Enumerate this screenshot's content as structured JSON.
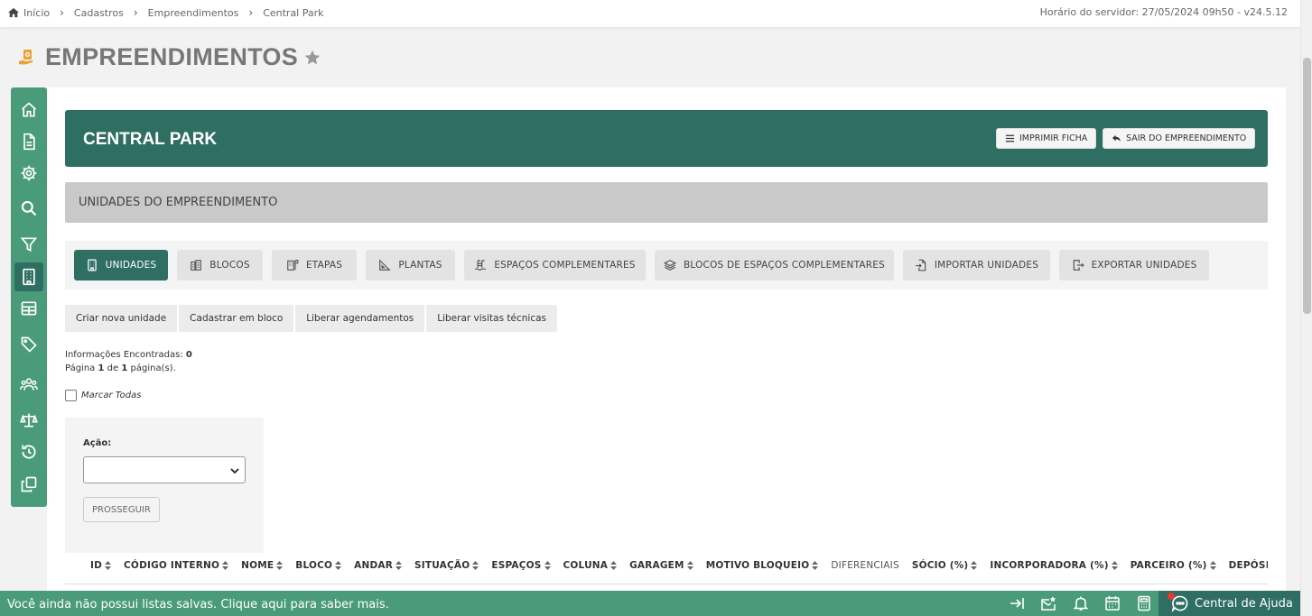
{
  "breadcrumb": [
    "Início",
    "Cadastros",
    "Empreendimentos",
    "Central Park"
  ],
  "server_info": "Horário do servidor: 27/05/2024 09h50 - v24.5.12",
  "page_title": "EMPREENDIMENTOS",
  "sidebar_icons": [
    "home-icon",
    "document-icon",
    "gear-icon",
    "search-icon",
    "filter-icon",
    "building-icon",
    "table-icon",
    "tag-icon",
    "users-icon",
    "scale-icon",
    "history-icon",
    "copy-icon"
  ],
  "banner": {
    "title": "CENTRAL PARK",
    "print_label": "IMPRIMIR FICHA",
    "exit_label": "SAIR DO EMPREENDIMENTO"
  },
  "section_title": "UNIDADES DO EMPREENDIMENTO",
  "tabs": [
    {
      "label": "UNIDADES",
      "icon": "building-icon",
      "active": true
    },
    {
      "label": "BLOCOS",
      "icon": "blocks-icon"
    },
    {
      "label": "ETAPAS",
      "icon": "flag-building-icon"
    },
    {
      "label": "PLANTAS",
      "icon": "ruler-icon"
    },
    {
      "label": "ESPAÇOS COMPLEMENTARES",
      "icon": "pool-icon"
    },
    {
      "label": "BLOCOS DE ESPAÇOS COMPLEMENTARES",
      "icon": "layers-icon"
    },
    {
      "label": "IMPORTAR UNIDADES",
      "icon": "import-icon"
    },
    {
      "label": "EXPORTAR UNIDADES",
      "icon": "export-icon"
    }
  ],
  "actions": [
    "Criar nova unidade",
    "Cadastrar em bloco",
    "Liberar agendamentos",
    "Liberar visitas técnicas"
  ],
  "info": {
    "found_label": "Informações Encontradas:",
    "found_count": "0",
    "page_prefix": "Página",
    "page_current": "1",
    "page_of": "de",
    "page_total": "1",
    "page_suffix": "página(s)."
  },
  "mark_all": "Marcar Todas",
  "action_box": {
    "label": "Ação:",
    "selected": "",
    "proceed": "PROSSEGUIR"
  },
  "table_headers": [
    "ID",
    "CÓDIGO INTERNO",
    "NOME",
    "BLOCO",
    "ANDAR",
    "SITUAÇÃO",
    "ESPAÇOS",
    "COLUNA",
    "GARAGEM",
    "MOTIVO BLOQUEIO",
    "DIFERENCIAIS",
    "SÓCIO (%)",
    "INCORPORADORA (%)",
    "PARCEIRO (%)",
    "DEPÓSITO"
  ],
  "footer": {
    "message": "Você ainda não possui listas salvas. Clique aqui para saber mais.",
    "help_label": "Central de Ajuda"
  },
  "colors": {
    "primary_dark": "#2f6e62",
    "primary": "#4a9b79",
    "alert_dot": "#e53935"
  }
}
